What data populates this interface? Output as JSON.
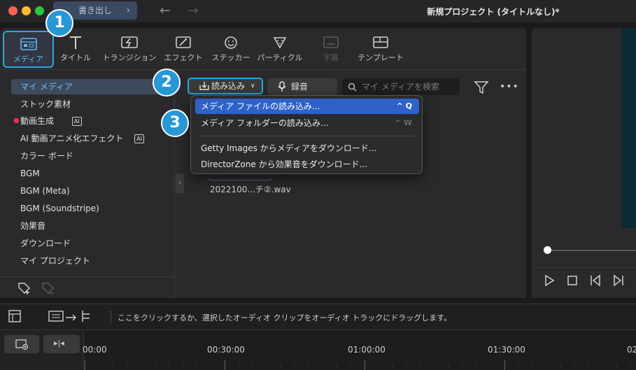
{
  "window": {
    "title": "新規プロジェクト (タイトルなし)*",
    "export_label": "書き出し",
    "traffic_colors": {
      "close": "#ff5f57",
      "minimize": "#febc2e",
      "zoom": "#28c840"
    },
    "accent": "#2aa8e0"
  },
  "toolbar": {
    "tabs": [
      {
        "label": "メディア",
        "icon": "media-icon"
      },
      {
        "label": "タイトル",
        "icon": "title-icon"
      },
      {
        "label": "トランジション",
        "icon": "transition-icon"
      },
      {
        "label": "エフェクト",
        "icon": "effect-icon"
      },
      {
        "label": "ステッカー",
        "icon": "sticker-icon"
      },
      {
        "label": "パーティクル",
        "icon": "particle-icon"
      },
      {
        "label": "字幕",
        "icon": "subtitle-icon"
      },
      {
        "label": "テンプレート",
        "icon": "template-icon"
      }
    ]
  },
  "callouts": {
    "one": "1",
    "two": "2",
    "three": "3"
  },
  "sidebar": {
    "items": [
      {
        "label": "マイ メディア"
      },
      {
        "label": "ストック素材"
      },
      {
        "label": "動画生成"
      },
      {
        "label": "AI 動画アニメ化エフェクト"
      },
      {
        "label": "カラー ボード"
      },
      {
        "label": "BGM"
      },
      {
        "label": "BGM (Meta)"
      },
      {
        "label": "BGM (Soundstripe)"
      },
      {
        "label": "効果音"
      },
      {
        "label": "ダウンロード"
      },
      {
        "label": "マイ プロジェクト"
      }
    ],
    "ai_badge": "AI"
  },
  "media_toolbar": {
    "import_label": "読み込み",
    "record_label": "録音",
    "search_placeholder": "マイ メディアを検索"
  },
  "import_menu": {
    "items": [
      {
        "label": "メディア ファイルの読み込み...",
        "shortcut": "^ Q"
      },
      {
        "label": "メディア フォルダーの読み込み...",
        "shortcut": "^ W"
      },
      {
        "label": "Getty Images からメディアをダウンロード..."
      },
      {
        "label": "DirectorZone から効果音をダウンロード..."
      }
    ]
  },
  "media": {
    "caption": "2022100...チ②.wav"
  },
  "timeline": {
    "hint": "ここをクリックするか、選択したオーディオ クリップをオーディオ トラックにドラッグします。",
    "ticks": [
      "00:00",
      "00:30:00",
      "01:00:00",
      "01:30:00",
      "02"
    ]
  }
}
